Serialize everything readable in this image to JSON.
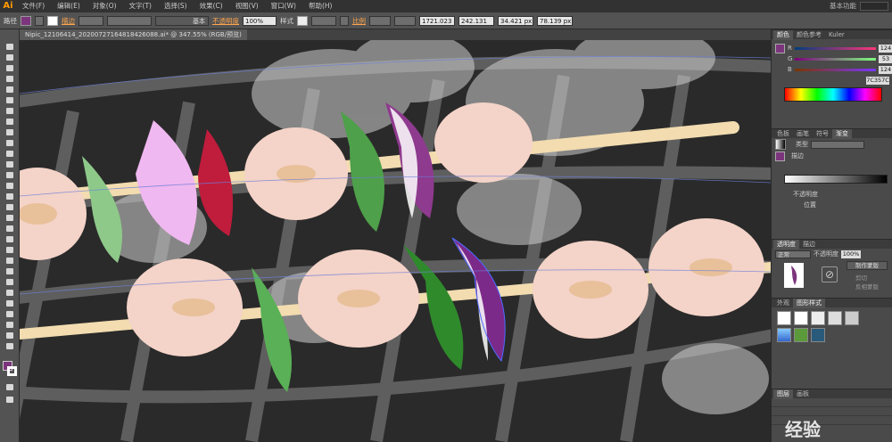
{
  "app": {
    "logo": "Ai",
    "workspace": "基本功能"
  },
  "menu": [
    "文件(F)",
    "编辑(E)",
    "对象(O)",
    "文字(T)",
    "选择(S)",
    "效果(C)",
    "视图(V)",
    "窗口(W)",
    "帮助(H)"
  ],
  "control": {
    "selection_label": "路径",
    "stroke_label": "描边",
    "stroke_style": "基本",
    "opacity_label": "不透明度",
    "opacity_value": "100%",
    "style_label": "样式",
    "ratio_label": "比例",
    "x_value": "1721.023",
    "y_value": "242.131",
    "w_value": "34.421 px",
    "h_value": "78.139 px"
  },
  "document": {
    "tab_title": "Nipic_12106414_20200727164818426088.ai* @ 347.55% (RGB/预览)"
  },
  "color_panel": {
    "tabs": [
      "颜色",
      "颜色参考",
      "Kuler"
    ],
    "r_label": "R",
    "g_label": "G",
    "b_label": "B",
    "r_value": "124",
    "g_value": "53",
    "b_value": "124",
    "hex_value": "7C357C",
    "colors": {
      "fill": "#7c357c",
      "r_track": "#ff6680",
      "g_track": "#55cc55",
      "b_track": "#6a6aff"
    }
  },
  "gradient_panel": {
    "tabs": [
      "色板",
      "画笔",
      "符号",
      "渐变"
    ],
    "type_label": "类型",
    "stroke_label": "描边",
    "opacity_label": "不透明度",
    "position_label": "位置"
  },
  "transparency_panel": {
    "tabs": [
      "透明度",
      "描边"
    ],
    "mode": "正常",
    "opacity_label": "不透明度",
    "opacity_value": "100%",
    "make_mask": "制作蒙版",
    "clip": "剪切",
    "invert_mask": "反相蒙版"
  },
  "graphic_styles_panel": {
    "tabs": [
      "外观",
      "图形样式"
    ]
  },
  "layers_panel": {
    "tabs": [
      "图层",
      "画板"
    ]
  },
  "watermark": "经验"
}
